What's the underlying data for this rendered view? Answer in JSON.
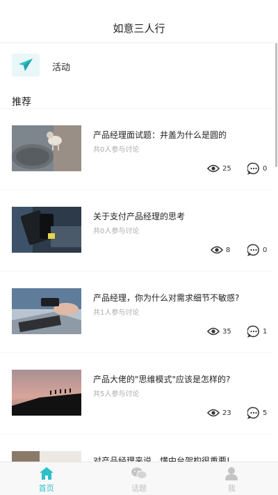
{
  "header": {
    "title": "如意三人行"
  },
  "activity": {
    "label": "活动",
    "accent": "#2cc0c9"
  },
  "section": {
    "title": "推荐"
  },
  "posts": [
    {
      "title": "产品经理面试题：井盖为什么是圆的",
      "sub": "共0人参与讨论",
      "views": "25",
      "comments": "0"
    },
    {
      "title": "关于支付产品经理的思考",
      "sub": "共0人参与讨论",
      "views": "8",
      "comments": "0"
    },
    {
      "title": "产品经理，你为什么对需求细节不敏感?",
      "sub": "共1人参与讨论",
      "views": "35",
      "comments": "1"
    },
    {
      "title": "产品大佬的\"思维模式\"应该是怎样的?",
      "sub": "共5人参与讨论",
      "views": "23",
      "comments": "5"
    },
    {
      "title": "对产品经理来说，懂中台架构很重要!",
      "sub": "",
      "views": "",
      "comments": ""
    }
  ],
  "tabs": [
    {
      "label": "首页",
      "icon": "home-icon",
      "active": true
    },
    {
      "label": "话题",
      "icon": "chat-icon",
      "active": false
    },
    {
      "label": "我",
      "icon": "user-icon",
      "active": false
    }
  ],
  "colors": {
    "accent": "#2cc0c9",
    "inactive": "#bdbdbd"
  }
}
